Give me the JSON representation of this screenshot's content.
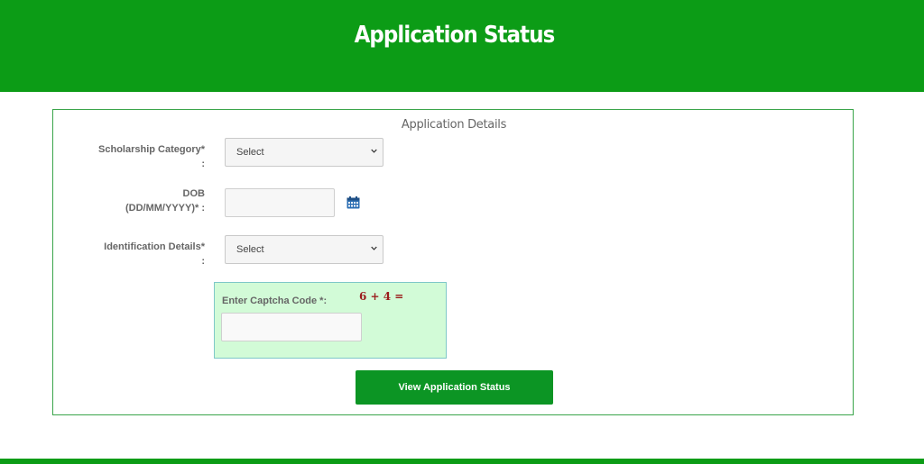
{
  "header": {
    "title": "Application Status"
  },
  "form": {
    "title": "Application Details",
    "scholarship_category": {
      "label_line1": "Scholarship Category*",
      "label_line2": ":",
      "value": "Select"
    },
    "dob": {
      "label_line1": "DOB",
      "label_line2": "(DD/MM/YYYY)* :",
      "value": ""
    },
    "identification": {
      "label_line1": "Identification Details*",
      "label_line2": ":",
      "value": "Select"
    },
    "captcha": {
      "label": "Enter Captcha Code *:",
      "question": "6 + 4 =",
      "value": ""
    },
    "submit_label": "View Application Status"
  },
  "icons": {
    "calendar": "calendar-icon",
    "dropdown": "chevron-down-icon"
  },
  "colors": {
    "primary_green": "#0c9c16",
    "captcha_bg": "#d2fbd7",
    "captcha_text": "#9b1c1c"
  }
}
